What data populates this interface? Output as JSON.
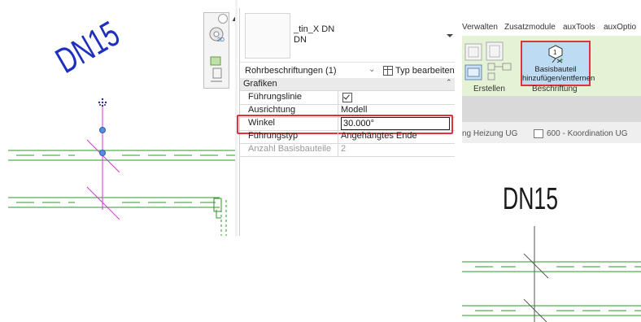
{
  "canvas": {
    "tag_text": "DN15",
    "tag_color": "#1f2fbf",
    "pipe_color": "#2a9a2a",
    "leader_color": "#d23ad2"
  },
  "properties": {
    "type_name_line1": "_tin_X DN",
    "type_name_line2": "DN",
    "selector": "Rohrbeschriftungen (1)",
    "edit_type": "Typ bearbeiten",
    "group": "Grafiken",
    "rows": [
      {
        "label": "Führungslinie",
        "value": "",
        "checkbox": true
      },
      {
        "label": "Ausrichtung",
        "value": "Modell"
      },
      {
        "label": "Winkel",
        "value": "30.000°"
      },
      {
        "label": "Führungstyp",
        "value": "Angehängtes Ende"
      },
      {
        "label": "Anzahl Basisbauteile",
        "value": "2"
      }
    ],
    "highlight_color": "#e0323c"
  },
  "ribbon": {
    "tabs": [
      "Verwalten",
      "Zusatzmodule",
      "auxTools",
      "auxOptio"
    ],
    "button_line1": "Basisbauteil",
    "button_line2": "hinzufügen/entfernen",
    "panel_erstellen": "Erstellen",
    "panel_beschriftung": "Beschriftung",
    "view_tab_1": "ng Heizung UG",
    "view_tab_2": "600 - Koordination UG",
    "panel_color": "#e6f2d6",
    "button_color": "#bedbf4"
  },
  "illustration": {
    "tag_text": "DN15"
  }
}
